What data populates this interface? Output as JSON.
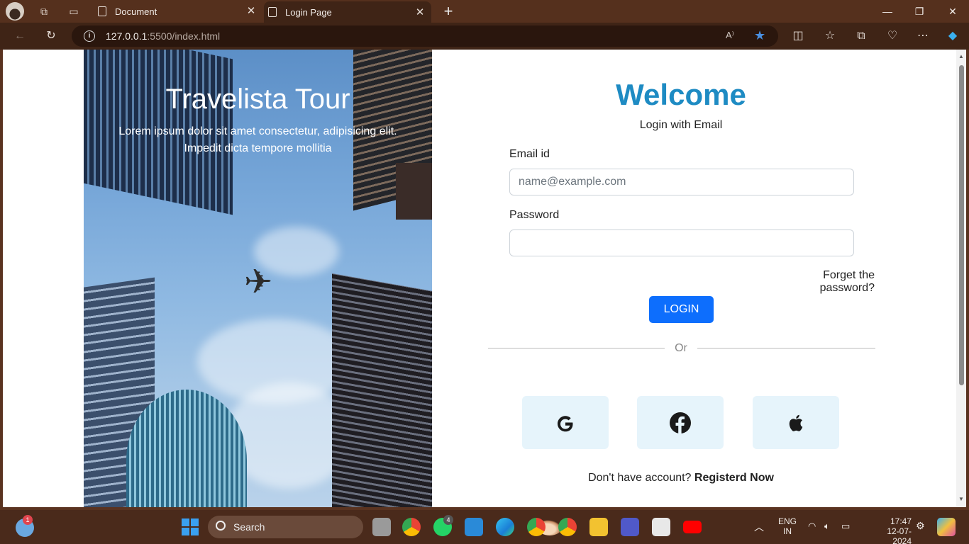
{
  "browser": {
    "tabs": [
      {
        "label": "Document",
        "active": false
      },
      {
        "label": "Login Page",
        "active": true
      }
    ],
    "url_host": "127.0.0.1",
    "url_path": ":5500/index.html"
  },
  "hero": {
    "title": "Travelista Tour",
    "subtitle_line1": "Lorem ipsum dolor sit amet consectetur, adipisicing elit.",
    "subtitle_line2": "Impedit dicta tempore mollitia"
  },
  "form": {
    "heading": "Welcome",
    "subheading": "Login with Email",
    "email_label": "Email id",
    "email_placeholder": "name@example.com",
    "password_label": "Password",
    "forgot_link": "Forget the password?",
    "login_button": "LOGIN",
    "divider_text": "Or",
    "register_prompt": "Don't have account?",
    "register_link": "Registerd Now",
    "social_buttons": [
      "google-icon",
      "facebook-icon",
      "apple-icon"
    ],
    "accent_color": "#1e8bc3",
    "button_color": "#0d6efd"
  },
  "taskbar": {
    "search_label": "Search",
    "weather_badge": "1",
    "whatsapp_badge": "4",
    "language_line1": "ENG",
    "language_line2": "IN",
    "time": "17:47",
    "date": "12-07-2024"
  }
}
